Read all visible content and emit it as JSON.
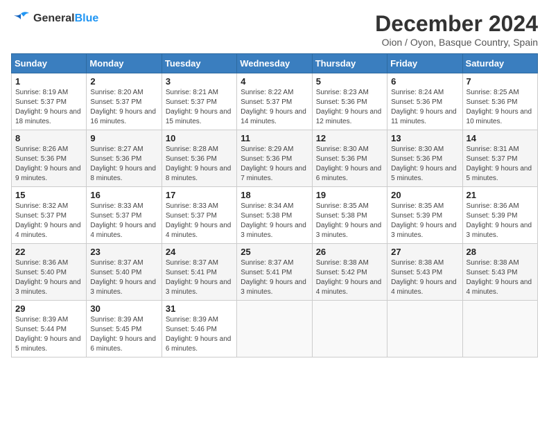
{
  "logo": {
    "line1": "General",
    "line2": "Blue"
  },
  "title": "December 2024",
  "location": "Oion / Oyon, Basque Country, Spain",
  "weekdays": [
    "Sunday",
    "Monday",
    "Tuesday",
    "Wednesday",
    "Thursday",
    "Friday",
    "Saturday"
  ],
  "weeks": [
    [
      {
        "day": "1",
        "sunrise": "8:19 AM",
        "sunset": "5:37 PM",
        "daylight": "9 hours and 18 minutes."
      },
      {
        "day": "2",
        "sunrise": "8:20 AM",
        "sunset": "5:37 PM",
        "daylight": "9 hours and 16 minutes."
      },
      {
        "day": "3",
        "sunrise": "8:21 AM",
        "sunset": "5:37 PM",
        "daylight": "9 hours and 15 minutes."
      },
      {
        "day": "4",
        "sunrise": "8:22 AM",
        "sunset": "5:37 PM",
        "daylight": "9 hours and 14 minutes."
      },
      {
        "day": "5",
        "sunrise": "8:23 AM",
        "sunset": "5:36 PM",
        "daylight": "9 hours and 12 minutes."
      },
      {
        "day": "6",
        "sunrise": "8:24 AM",
        "sunset": "5:36 PM",
        "daylight": "9 hours and 11 minutes."
      },
      {
        "day": "7",
        "sunrise": "8:25 AM",
        "sunset": "5:36 PM",
        "daylight": "9 hours and 10 minutes."
      }
    ],
    [
      {
        "day": "8",
        "sunrise": "8:26 AM",
        "sunset": "5:36 PM",
        "daylight": "9 hours and 9 minutes."
      },
      {
        "day": "9",
        "sunrise": "8:27 AM",
        "sunset": "5:36 PM",
        "daylight": "9 hours and 8 minutes."
      },
      {
        "day": "10",
        "sunrise": "8:28 AM",
        "sunset": "5:36 PM",
        "daylight": "9 hours and 8 minutes."
      },
      {
        "day": "11",
        "sunrise": "8:29 AM",
        "sunset": "5:36 PM",
        "daylight": "9 hours and 7 minutes."
      },
      {
        "day": "12",
        "sunrise": "8:30 AM",
        "sunset": "5:36 PM",
        "daylight": "9 hours and 6 minutes."
      },
      {
        "day": "13",
        "sunrise": "8:30 AM",
        "sunset": "5:36 PM",
        "daylight": "9 hours and 5 minutes."
      },
      {
        "day": "14",
        "sunrise": "8:31 AM",
        "sunset": "5:37 PM",
        "daylight": "9 hours and 5 minutes."
      }
    ],
    [
      {
        "day": "15",
        "sunrise": "8:32 AM",
        "sunset": "5:37 PM",
        "daylight": "9 hours and 4 minutes."
      },
      {
        "day": "16",
        "sunrise": "8:33 AM",
        "sunset": "5:37 PM",
        "daylight": "9 hours and 4 minutes."
      },
      {
        "day": "17",
        "sunrise": "8:33 AM",
        "sunset": "5:37 PM",
        "daylight": "9 hours and 4 minutes."
      },
      {
        "day": "18",
        "sunrise": "8:34 AM",
        "sunset": "5:38 PM",
        "daylight": "9 hours and 3 minutes."
      },
      {
        "day": "19",
        "sunrise": "8:35 AM",
        "sunset": "5:38 PM",
        "daylight": "9 hours and 3 minutes."
      },
      {
        "day": "20",
        "sunrise": "8:35 AM",
        "sunset": "5:39 PM",
        "daylight": "9 hours and 3 minutes."
      },
      {
        "day": "21",
        "sunrise": "8:36 AM",
        "sunset": "5:39 PM",
        "daylight": "9 hours and 3 minutes."
      }
    ],
    [
      {
        "day": "22",
        "sunrise": "8:36 AM",
        "sunset": "5:40 PM",
        "daylight": "9 hours and 3 minutes."
      },
      {
        "day": "23",
        "sunrise": "8:37 AM",
        "sunset": "5:40 PM",
        "daylight": "9 hours and 3 minutes."
      },
      {
        "day": "24",
        "sunrise": "8:37 AM",
        "sunset": "5:41 PM",
        "daylight": "9 hours and 3 minutes."
      },
      {
        "day": "25",
        "sunrise": "8:37 AM",
        "sunset": "5:41 PM",
        "daylight": "9 hours and 3 minutes."
      },
      {
        "day": "26",
        "sunrise": "8:38 AM",
        "sunset": "5:42 PM",
        "daylight": "9 hours and 4 minutes."
      },
      {
        "day": "27",
        "sunrise": "8:38 AM",
        "sunset": "5:43 PM",
        "daylight": "9 hours and 4 minutes."
      },
      {
        "day": "28",
        "sunrise": "8:38 AM",
        "sunset": "5:43 PM",
        "daylight": "9 hours and 4 minutes."
      }
    ],
    [
      {
        "day": "29",
        "sunrise": "8:39 AM",
        "sunset": "5:44 PM",
        "daylight": "9 hours and 5 minutes."
      },
      {
        "day": "30",
        "sunrise": "8:39 AM",
        "sunset": "5:45 PM",
        "daylight": "9 hours and 6 minutes."
      },
      {
        "day": "31",
        "sunrise": "8:39 AM",
        "sunset": "5:46 PM",
        "daylight": "9 hours and 6 minutes."
      },
      null,
      null,
      null,
      null
    ]
  ]
}
